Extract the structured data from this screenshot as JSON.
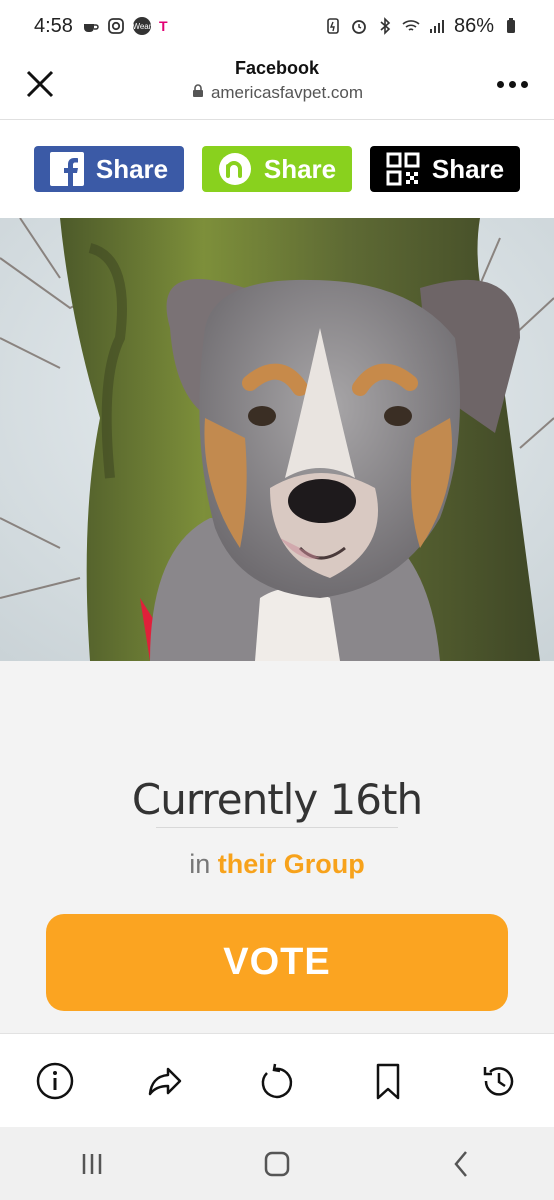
{
  "status_bar": {
    "time": "4:58",
    "carrier_icon": "T",
    "wear_label": "Wear",
    "battery": "86%"
  },
  "browser": {
    "title": "Facebook",
    "url": "americasfavpet.com"
  },
  "share_buttons": [
    {
      "label": "Share",
      "icon": "facebook-icon",
      "color": "#3b5aa6"
    },
    {
      "label": "Share",
      "icon": "nextdoor-icon",
      "color": "#89d11e"
    },
    {
      "label": "Share",
      "icon": "qr-code-icon",
      "color": "#000000"
    }
  ],
  "pet": {
    "rank_text": "Currently 16th",
    "group_prefix": "in",
    "group_link": "their Group",
    "vote_label": "VOTE"
  },
  "colors": {
    "accent_orange": "#fba421",
    "group_orange": "#f7a21b",
    "page_bg": "#f3f3f3"
  }
}
